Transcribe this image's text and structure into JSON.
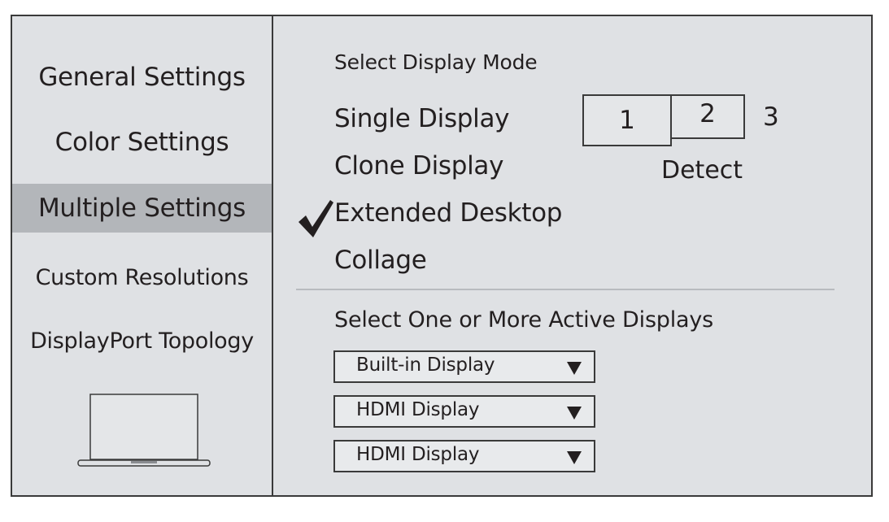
{
  "sidebar": {
    "items": [
      {
        "label": "General Settings"
      },
      {
        "label": "Color Settings"
      },
      {
        "label": "Multiple Settings",
        "active": true
      },
      {
        "label": "Custom Resolutions"
      },
      {
        "label": "DisplayPort Topology"
      }
    ],
    "device_icon": "laptop-icon"
  },
  "main": {
    "display_mode": {
      "heading": "Select Display Mode",
      "options": [
        {
          "label": "Single Display",
          "checked": false
        },
        {
          "label": "Clone Display",
          "checked": false
        },
        {
          "label": "Extended Desktop",
          "checked": true
        },
        {
          "label": "Collage",
          "checked": false
        }
      ],
      "displays": [
        "1",
        "2",
        "3"
      ],
      "detect_label": "Detect"
    },
    "active_displays": {
      "heading": "Select One or More Active Displays",
      "dropdowns": [
        {
          "value": "Built-in Display"
        },
        {
          "value": "HDMI Display"
        },
        {
          "value": "HDMI Display"
        }
      ]
    }
  },
  "colors": {
    "background": "#dfe1e4",
    "active_item": "#b3b6ba",
    "border": "#3a3a3a",
    "divider": "#b8bbbf"
  }
}
